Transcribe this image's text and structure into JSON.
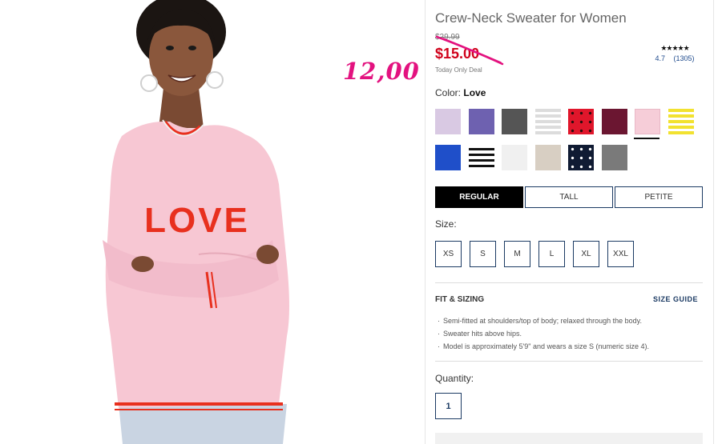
{
  "product": {
    "title": "Crew-Neck Sweater for Women",
    "original_price": "$29.99",
    "sale_price": "$15.00",
    "deal_label": "Today Only Deal",
    "rating_value": "4.7",
    "review_count": "(1305)",
    "stars": "★★★★★",
    "rating_fraction": 0.94
  },
  "annotation": {
    "handwritten_price": "12,00",
    "color": "#e3127f"
  },
  "photo": {
    "sweater_text": "LOVE",
    "sweater_color": "#f7c7d3",
    "text_color": "#e8301e"
  },
  "color": {
    "label": "Color:",
    "selected_name": "Love",
    "swatches": [
      {
        "name": "lavender",
        "color": "#d9c9e3",
        "pattern": "solid"
      },
      {
        "name": "periwinkle",
        "color": "#6e61b0",
        "pattern": "solid"
      },
      {
        "name": "charcoal",
        "color": "#555555",
        "pattern": "solid"
      },
      {
        "name": "grey-stripe",
        "color": "#dcdcdc",
        "pattern": "stripe",
        "stripe_color": "#ffffff"
      },
      {
        "name": "red-dot",
        "color": "#e0162b",
        "pattern": "dot",
        "dot_color": "#2a0d0d"
      },
      {
        "name": "burgundy",
        "color": "#6b1631",
        "pattern": "solid"
      },
      {
        "name": "love-pink",
        "color": "#f6cdd8",
        "pattern": "solid",
        "selected": true
      },
      {
        "name": "yellow-stripe",
        "color": "#f2e230",
        "pattern": "stripe",
        "stripe_color": "#ffffff"
      },
      {
        "name": "cobalt",
        "color": "#1f4fc9",
        "pattern": "solid"
      },
      {
        "name": "black-white-stripe",
        "color": "#ffffff",
        "pattern": "stripe",
        "stripe_color": "#111111"
      },
      {
        "name": "white",
        "color": "#f0f0f0",
        "pattern": "solid"
      },
      {
        "name": "oatmeal",
        "color": "#d8cfc3",
        "pattern": "solid"
      },
      {
        "name": "navy-dot",
        "color": "#101b33",
        "pattern": "dot",
        "dot_color": "#ffffff"
      },
      {
        "name": "heather-grey",
        "color": "#7a7a7a",
        "pattern": "solid"
      }
    ]
  },
  "fit_tabs": [
    {
      "label": "REGULAR",
      "active": true
    },
    {
      "label": "TALL",
      "active": false
    },
    {
      "label": "PETITE",
      "active": false
    }
  ],
  "size": {
    "label": "Size:",
    "options": [
      "XS",
      "S",
      "M",
      "L",
      "XL",
      "XXL"
    ]
  },
  "fit_sizing": {
    "heading": "FIT & SIZING",
    "guide_link": "SIZE GUIDE",
    "bullets": [
      "Semi-fitted at shoulders/top of body; relaxed through the body.",
      "Sweater hits above hips.",
      "Model is approximately 5'9\" and wears a size S (numeric size 4)."
    ]
  },
  "quantity": {
    "label": "Quantity:",
    "value": "1"
  }
}
